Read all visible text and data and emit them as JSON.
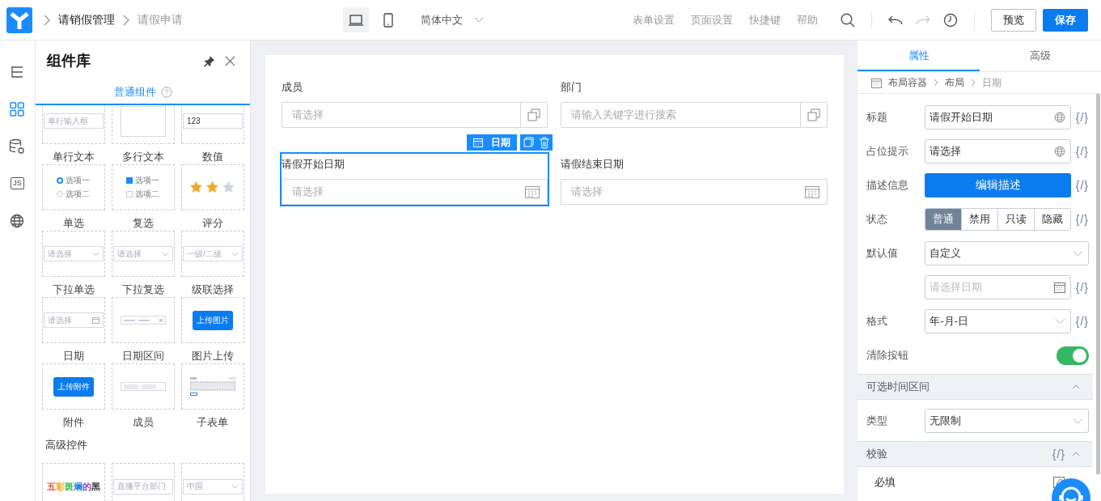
{
  "header": {
    "breadcrumb": [
      {
        "label": "请销假管理",
        "current": false
      },
      {
        "label": "请假申请",
        "current": true
      }
    ],
    "devices": [
      {
        "kind": "desktop",
        "selected": true
      },
      {
        "kind": "mobile",
        "selected": false
      }
    ],
    "language": "简体中文",
    "menu": [
      "表单设置",
      "页面设置",
      "快捷键",
      "帮助"
    ],
    "history": [
      {
        "kind": "undo",
        "disabled": false
      },
      {
        "kind": "redo",
        "disabled": true
      },
      {
        "kind": "history",
        "disabled": false
      }
    ],
    "buttons": [
      {
        "label": "预览",
        "kind": "secondary"
      },
      {
        "label": "保存",
        "kind": "primary"
      }
    ]
  },
  "rail": [
    {
      "kind": "outline",
      "selected": false
    },
    {
      "kind": "components",
      "selected": true
    },
    {
      "kind": "datasource",
      "selected": false
    },
    {
      "kind": "script",
      "label": "JS",
      "selected": false
    },
    {
      "kind": "i18n",
      "selected": false
    }
  ],
  "library": {
    "title": "组件库",
    "tab": {
      "label": "普通组件",
      "selected": true
    },
    "components": [
      {
        "label": "单行文本",
        "kind": "input",
        "text": "单行输入框"
      },
      {
        "label": "多行文本",
        "kind": "textarea"
      },
      {
        "label": "数值",
        "kind": "number",
        "text": "123"
      },
      {
        "label": "单选",
        "kind": "radio",
        "options": [
          {
            "text": "选项一",
            "selected": true
          },
          {
            "text": "选项二",
            "selected": false
          }
        ]
      },
      {
        "label": "复选",
        "kind": "checkbox",
        "options": [
          {
            "text": "选项一",
            "checked": true
          },
          {
            "text": "选项二",
            "checked": false
          }
        ]
      },
      {
        "label": "评分",
        "kind": "rate",
        "stars": 2
      },
      {
        "label": "下拉单选",
        "kind": "select",
        "text": "请选择"
      },
      {
        "label": "下拉复选",
        "kind": "select",
        "text": "请选择"
      },
      {
        "label": "级联选择",
        "kind": "select",
        "text": "一级/二级"
      },
      {
        "label": "日期",
        "kind": "date",
        "text": "请选择"
      },
      {
        "label": "日期区间",
        "kind": "daterange"
      },
      {
        "label": "图片上传",
        "kind": "button",
        "text": "上传图片"
      },
      {
        "label": "附件",
        "kind": "button",
        "text": "上传附件"
      },
      {
        "label": "成员",
        "kind": "tags"
      },
      {
        "label": "子表单",
        "kind": "subform"
      }
    ],
    "advanced_title": "高级控件",
    "advanced": [
      {
        "kind": "rainbow",
        "text": "五彩斑斓的黑"
      },
      {
        "kind": "select",
        "text": "直播平台部门"
      },
      {
        "kind": "select",
        "text": "中国"
      }
    ]
  },
  "canvas": {
    "toolbar": {
      "label": "日期"
    },
    "fields": [
      {
        "label": "成员",
        "placeholder": "请选择",
        "kind": "picker",
        "selected": false
      },
      {
        "label": "部门",
        "placeholder": "请输入关键字进行搜索",
        "kind": "picker",
        "selected": false
      },
      {
        "label": "请假开始日期",
        "placeholder": "请选择",
        "kind": "date",
        "selected": true
      },
      {
        "label": "请假结束日期",
        "placeholder": "请选择",
        "kind": "date",
        "selected": false
      }
    ]
  },
  "properties": {
    "tabs": [
      {
        "label": "属性",
        "selected": true
      },
      {
        "label": "高级",
        "selected": false
      }
    ],
    "path": [
      "布局容器",
      "布局",
      "日期"
    ],
    "rows": [
      {
        "kind": "text",
        "label": "标题",
        "value": "请假开始日期",
        "expr": "{/}"
      },
      {
        "kind": "text",
        "label": "占位提示",
        "value": "请选择",
        "expr": "{/}"
      },
      {
        "kind": "button",
        "label": "描述信息",
        "value": "编辑描述",
        "expr": "{/}"
      },
      {
        "kind": "segmented",
        "label": "状态",
        "options": [
          {
            "label": "普通",
            "selected": true
          },
          {
            "label": "禁用",
            "selected": false
          },
          {
            "label": "只读",
            "selected": false
          },
          {
            "label": "隐藏",
            "selected": false
          }
        ],
        "expr": "{/}"
      },
      {
        "kind": "select",
        "label": "默认值",
        "value": "自定义"
      },
      {
        "kind": "date",
        "placeholder": "请选择日期",
        "expr": "{/}"
      },
      {
        "kind": "select",
        "label": "格式",
        "value": "年-月-日",
        "expr": "{/}"
      },
      {
        "kind": "switch",
        "label": "清除按钮",
        "on": true
      }
    ],
    "sections": [
      {
        "title": "可选时间区间",
        "expanded": true,
        "rows": [
          {
            "kind": "select",
            "label": "类型",
            "value": "无限制"
          }
        ]
      },
      {
        "title": "校验",
        "expanded": true,
        "expr": "{/}",
        "rows": [
          {
            "kind": "check",
            "label": "必填"
          }
        ]
      }
    ]
  }
}
